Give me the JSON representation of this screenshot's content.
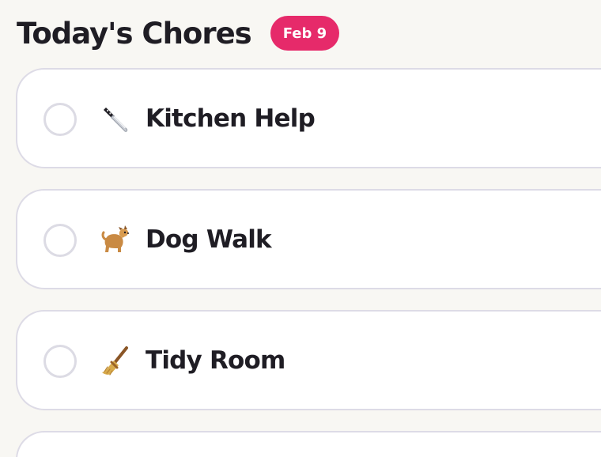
{
  "header": {
    "title": "Today's Chores",
    "date_badge": "Feb 9"
  },
  "chores": [
    {
      "label": "Kitchen Help",
      "icon": "knife-icon",
      "completed": false
    },
    {
      "label": "Dog Walk",
      "icon": "dog-icon",
      "completed": false
    },
    {
      "label": "Tidy Room",
      "icon": "broom-icon",
      "completed": false
    }
  ],
  "colors": {
    "accent": "#e62a6a",
    "page_background": "#f8f7f3",
    "card_background": "#ffffff",
    "card_border": "#dddbe6",
    "text": "#1f1d24"
  }
}
